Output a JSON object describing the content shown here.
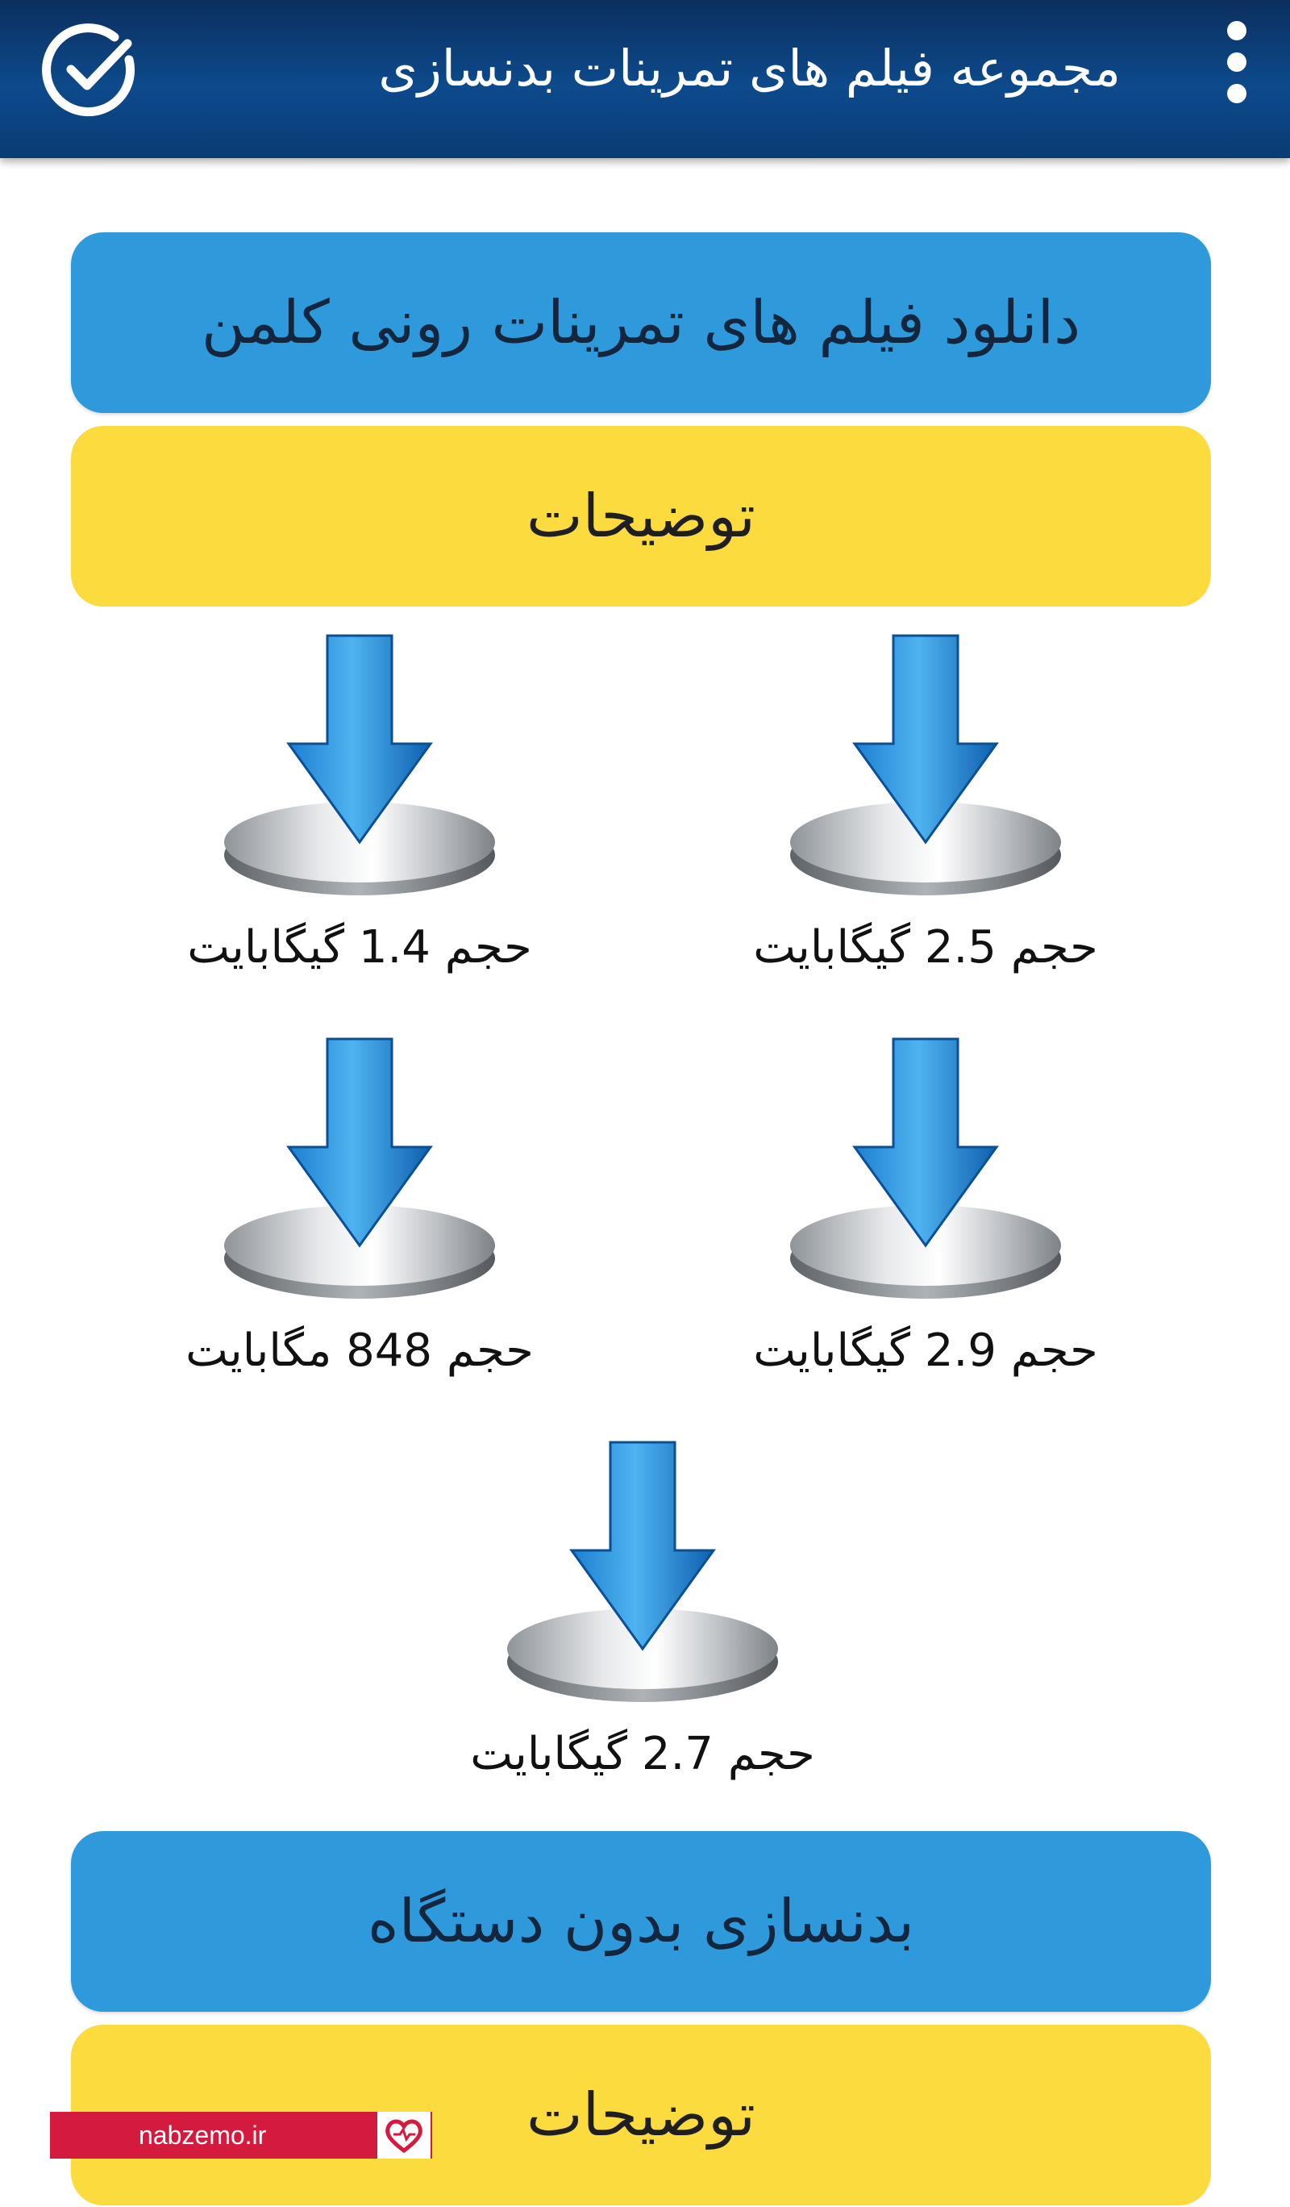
{
  "app_bar": {
    "title": "مجموعه فیلم های تمرینات بدنسازی",
    "menu_icon": "more-vert-icon",
    "check_icon": "check-circle-icon"
  },
  "sections": [
    {
      "label": "دانلود فیلم های تمرینات  رونی کلمن",
      "color": "#2f9adb"
    },
    {
      "label": "توضیحات",
      "color": "#fbdb3e"
    },
    {
      "label": "بدنسازی بدون دستگاه",
      "color": "#2f9adb"
    },
    {
      "label": "توضیحات",
      "color": "#fbdb3e"
    }
  ],
  "downloads": [
    {
      "size_label": "حجم 2.5 گیگابایت",
      "icon": "download-icon"
    },
    {
      "size_label": "حجم 1.4 گیگابایت",
      "icon": "download-icon"
    },
    {
      "size_label": "حجم 2.9 گیگابایت",
      "icon": "download-icon"
    },
    {
      "size_label": "حجم 848 مگابایت",
      "icon": "download-icon"
    },
    {
      "size_label": "حجم 2.7 گیگابایت",
      "icon": "download-icon"
    }
  ],
  "watermark": {
    "text": "nabzemo.ir",
    "icon": "heart-pulse-icon"
  },
  "colors": {
    "app_bar": "#0d4a8c",
    "accent_blue": "#2f9adb",
    "accent_yellow": "#fbdb3e",
    "watermark": "#d51b3d"
  }
}
